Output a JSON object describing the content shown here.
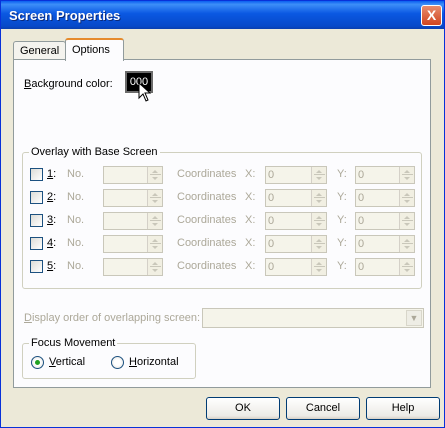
{
  "window": {
    "title": "Screen Properties",
    "close_glyph": "X"
  },
  "tabs": [
    {
      "label": "General"
    },
    {
      "label": "Options"
    }
  ],
  "background": {
    "label_u": "B",
    "label_rest": "ackground color:",
    "swatch_value": "000"
  },
  "overlay": {
    "title": "Overlay with Base Screen",
    "no_label": "No.",
    "coordinates_label": "Coordinates",
    "x_label": "X:",
    "y_label": "Y:",
    "rows": [
      {
        "num": "1",
        "suffix": ":",
        "x": "0",
        "y": "0"
      },
      {
        "num": "2",
        "suffix": ":",
        "x": "0",
        "y": "0"
      },
      {
        "num": "3",
        "suffix": ":",
        "x": "0",
        "y": "0"
      },
      {
        "num": "4",
        "suffix": ":",
        "x": "0",
        "y": "0"
      },
      {
        "num": "5",
        "suffix": ":",
        "x": "0",
        "y": "0"
      }
    ]
  },
  "display_order": {
    "label_u": "D",
    "label_rest": "isplay order of overlapping screen:",
    "value": ""
  },
  "focus": {
    "title": "Focus Movement",
    "vertical_u": "V",
    "vertical_rest": "ertical",
    "horizontal_u": "H",
    "horizontal_rest": "orizontal",
    "selected": "vertical"
  },
  "buttons": {
    "ok": "OK",
    "cancel": "Cancel",
    "help": "Help"
  },
  "colors": {
    "title_blue": "#0a58e2",
    "dialog_bg": "#ece9d8",
    "disabled_text": "#aca899"
  }
}
